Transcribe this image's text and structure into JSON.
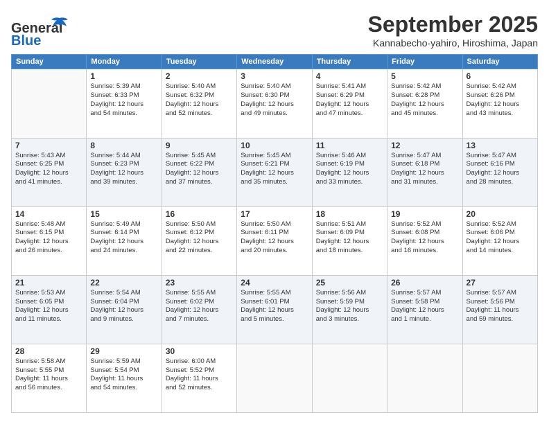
{
  "header": {
    "logo_line1": "General",
    "logo_line2": "Blue",
    "title": "September 2025",
    "subtitle": "Kannabecho-yahiro, Hiroshima, Japan"
  },
  "columns": [
    "Sunday",
    "Monday",
    "Tuesday",
    "Wednesday",
    "Thursday",
    "Friday",
    "Saturday"
  ],
  "weeks": [
    [
      {
        "day": "",
        "info": ""
      },
      {
        "day": "1",
        "info": "Sunrise: 5:39 AM\nSunset: 6:33 PM\nDaylight: 12 hours\nand 54 minutes."
      },
      {
        "day": "2",
        "info": "Sunrise: 5:40 AM\nSunset: 6:32 PM\nDaylight: 12 hours\nand 52 minutes."
      },
      {
        "day": "3",
        "info": "Sunrise: 5:40 AM\nSunset: 6:30 PM\nDaylight: 12 hours\nand 49 minutes."
      },
      {
        "day": "4",
        "info": "Sunrise: 5:41 AM\nSunset: 6:29 PM\nDaylight: 12 hours\nand 47 minutes."
      },
      {
        "day": "5",
        "info": "Sunrise: 5:42 AM\nSunset: 6:28 PM\nDaylight: 12 hours\nand 45 minutes."
      },
      {
        "day": "6",
        "info": "Sunrise: 5:42 AM\nSunset: 6:26 PM\nDaylight: 12 hours\nand 43 minutes."
      }
    ],
    [
      {
        "day": "7",
        "info": "Sunrise: 5:43 AM\nSunset: 6:25 PM\nDaylight: 12 hours\nand 41 minutes."
      },
      {
        "day": "8",
        "info": "Sunrise: 5:44 AM\nSunset: 6:23 PM\nDaylight: 12 hours\nand 39 minutes."
      },
      {
        "day": "9",
        "info": "Sunrise: 5:45 AM\nSunset: 6:22 PM\nDaylight: 12 hours\nand 37 minutes."
      },
      {
        "day": "10",
        "info": "Sunrise: 5:45 AM\nSunset: 6:21 PM\nDaylight: 12 hours\nand 35 minutes."
      },
      {
        "day": "11",
        "info": "Sunrise: 5:46 AM\nSunset: 6:19 PM\nDaylight: 12 hours\nand 33 minutes."
      },
      {
        "day": "12",
        "info": "Sunrise: 5:47 AM\nSunset: 6:18 PM\nDaylight: 12 hours\nand 31 minutes."
      },
      {
        "day": "13",
        "info": "Sunrise: 5:47 AM\nSunset: 6:16 PM\nDaylight: 12 hours\nand 28 minutes."
      }
    ],
    [
      {
        "day": "14",
        "info": "Sunrise: 5:48 AM\nSunset: 6:15 PM\nDaylight: 12 hours\nand 26 minutes."
      },
      {
        "day": "15",
        "info": "Sunrise: 5:49 AM\nSunset: 6:14 PM\nDaylight: 12 hours\nand 24 minutes."
      },
      {
        "day": "16",
        "info": "Sunrise: 5:50 AM\nSunset: 6:12 PM\nDaylight: 12 hours\nand 22 minutes."
      },
      {
        "day": "17",
        "info": "Sunrise: 5:50 AM\nSunset: 6:11 PM\nDaylight: 12 hours\nand 20 minutes."
      },
      {
        "day": "18",
        "info": "Sunrise: 5:51 AM\nSunset: 6:09 PM\nDaylight: 12 hours\nand 18 minutes."
      },
      {
        "day": "19",
        "info": "Sunrise: 5:52 AM\nSunset: 6:08 PM\nDaylight: 12 hours\nand 16 minutes."
      },
      {
        "day": "20",
        "info": "Sunrise: 5:52 AM\nSunset: 6:06 PM\nDaylight: 12 hours\nand 14 minutes."
      }
    ],
    [
      {
        "day": "21",
        "info": "Sunrise: 5:53 AM\nSunset: 6:05 PM\nDaylight: 12 hours\nand 11 minutes."
      },
      {
        "day": "22",
        "info": "Sunrise: 5:54 AM\nSunset: 6:04 PM\nDaylight: 12 hours\nand 9 minutes."
      },
      {
        "day": "23",
        "info": "Sunrise: 5:55 AM\nSunset: 6:02 PM\nDaylight: 12 hours\nand 7 minutes."
      },
      {
        "day": "24",
        "info": "Sunrise: 5:55 AM\nSunset: 6:01 PM\nDaylight: 12 hours\nand 5 minutes."
      },
      {
        "day": "25",
        "info": "Sunrise: 5:56 AM\nSunset: 5:59 PM\nDaylight: 12 hours\nand 3 minutes."
      },
      {
        "day": "26",
        "info": "Sunrise: 5:57 AM\nSunset: 5:58 PM\nDaylight: 12 hours\nand 1 minute."
      },
      {
        "day": "27",
        "info": "Sunrise: 5:57 AM\nSunset: 5:56 PM\nDaylight: 11 hours\nand 59 minutes."
      }
    ],
    [
      {
        "day": "28",
        "info": "Sunrise: 5:58 AM\nSunset: 5:55 PM\nDaylight: 11 hours\nand 56 minutes."
      },
      {
        "day": "29",
        "info": "Sunrise: 5:59 AM\nSunset: 5:54 PM\nDaylight: 11 hours\nand 54 minutes."
      },
      {
        "day": "30",
        "info": "Sunrise: 6:00 AM\nSunset: 5:52 PM\nDaylight: 11 hours\nand 52 minutes."
      },
      {
        "day": "",
        "info": ""
      },
      {
        "day": "",
        "info": ""
      },
      {
        "day": "",
        "info": ""
      },
      {
        "day": "",
        "info": ""
      }
    ]
  ]
}
